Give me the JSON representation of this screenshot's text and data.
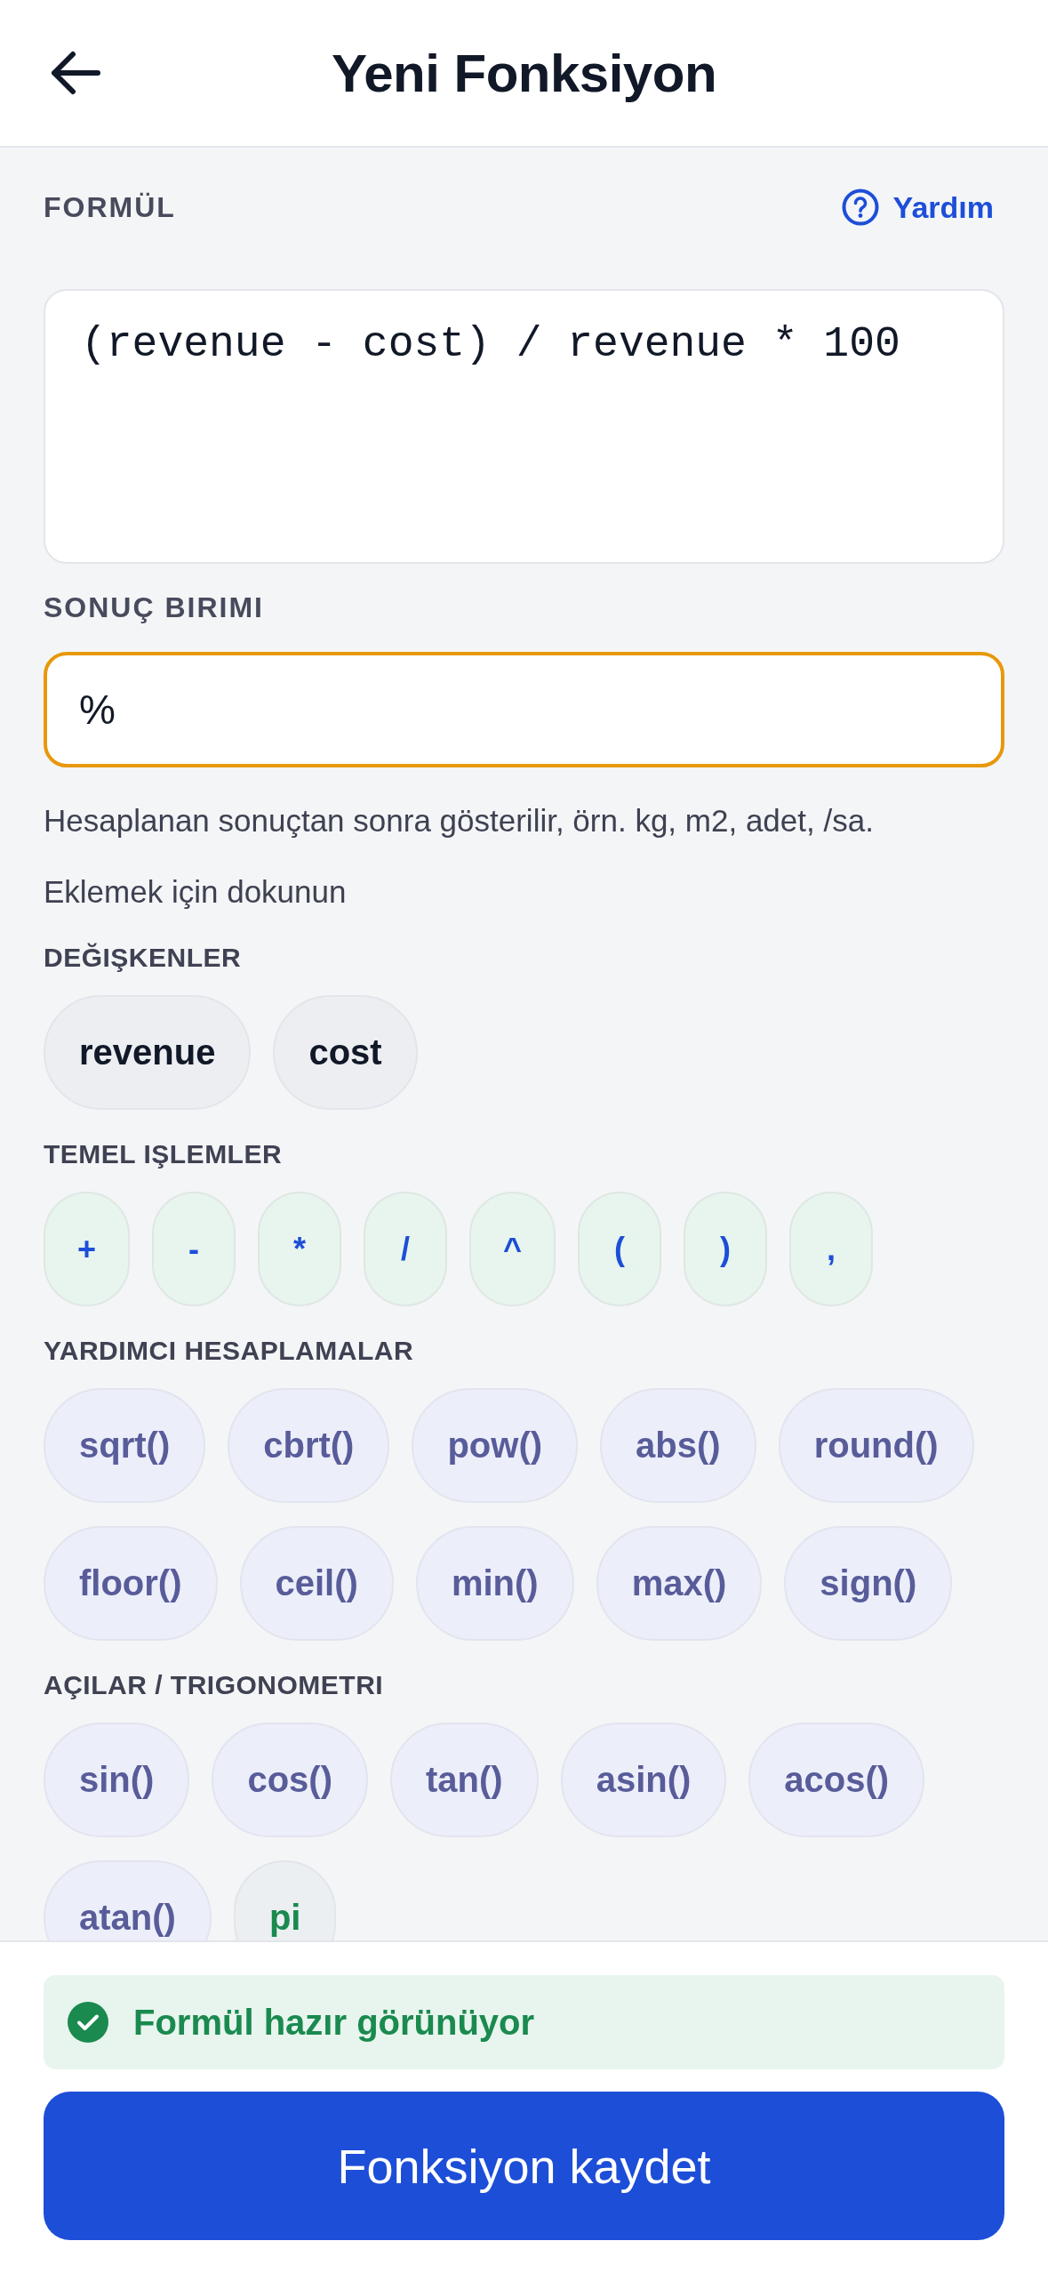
{
  "header": {
    "title": "Yeni Fonksiyon"
  },
  "formula": {
    "label": "FORMÜL",
    "help_link": "Yardım",
    "value": "(revenue - cost) / revenue * 100"
  },
  "unit": {
    "label": "SONUÇ BIRIMI",
    "value": "%",
    "focused": true,
    "hint": "Hesaplanan sonuçtan sonra gösterilir, örn. kg, m2, adet, /sa."
  },
  "palette": {
    "hint": "Eklemek için dokunun",
    "sections": [
      {
        "title": "DEĞIŞKENLER",
        "chips": [
          {
            "label": "revenue",
            "kind": "variable"
          },
          {
            "label": "cost",
            "kind": "variable"
          }
        ]
      },
      {
        "title": "TEMEL IŞLEMLER",
        "chips": [
          {
            "label": "+",
            "kind": "operator"
          },
          {
            "label": "-",
            "kind": "operator"
          },
          {
            "label": "*",
            "kind": "operator"
          },
          {
            "label": "/",
            "kind": "operator"
          },
          {
            "label": "^",
            "kind": "operator"
          },
          {
            "label": "(",
            "kind": "operator"
          },
          {
            "label": ")",
            "kind": "operator"
          },
          {
            "label": ",",
            "kind": "operator"
          }
        ]
      },
      {
        "title": "YARDIMCI HESAPLAMALAR",
        "chips": [
          {
            "label": "sqrt()",
            "kind": "function"
          },
          {
            "label": "cbrt()",
            "kind": "function"
          },
          {
            "label": "pow()",
            "kind": "function"
          },
          {
            "label": "abs()",
            "kind": "function"
          },
          {
            "label": "round()",
            "kind": "function"
          },
          {
            "label": "floor()",
            "kind": "function"
          },
          {
            "label": "ceil()",
            "kind": "function"
          },
          {
            "label": "min()",
            "kind": "function"
          },
          {
            "label": "max()",
            "kind": "function"
          },
          {
            "label": "sign()",
            "kind": "function"
          }
        ]
      },
      {
        "title": "AÇILAR / TRIGONOMETRI",
        "chips": [
          {
            "label": "sin()",
            "kind": "function"
          },
          {
            "label": "cos()",
            "kind": "function"
          },
          {
            "label": "tan()",
            "kind": "function"
          },
          {
            "label": "asin()",
            "kind": "function"
          },
          {
            "label": "acos()",
            "kind": "function"
          },
          {
            "label": "atan()",
            "kind": "function"
          },
          {
            "label": "pi",
            "kind": "constant"
          }
        ]
      }
    ]
  },
  "status": {
    "kind": "success",
    "text": "Formül hazır görünüyor"
  },
  "save_button": "Fonksiyon kaydet"
}
